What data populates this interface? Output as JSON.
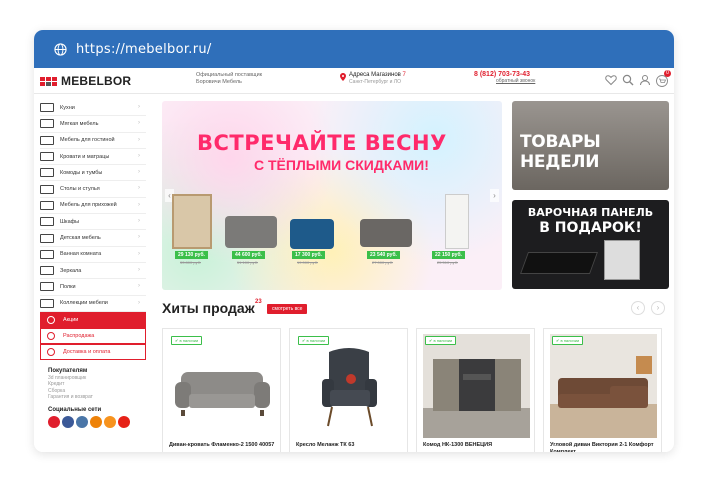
{
  "browser": {
    "url": "https://mebelbor.ru/"
  },
  "header": {
    "logo_text": "MEBELBOR",
    "official_line1": "Официальный поставщик",
    "official_line2": "Боровичи Мебель",
    "address_label": "Адреса Магазинов",
    "address_count": "7",
    "address_sub": "Санкт-Петербург и ЛО",
    "phone": "8 (812) 703-73-43",
    "callback": "обратный звонок",
    "cart_count": "0"
  },
  "sidebar": {
    "categories": [
      "Кухни",
      "Мягкая мебель",
      "Мебель для гостиной",
      "Кровати и матрацы",
      "Комоды и тумбы",
      "Столы и стулья",
      "Мебель для прихожей",
      "Шкафы",
      "Детская мебель",
      "Ванная комната",
      "Зеркала",
      "Полки",
      "Коллекции мебели"
    ],
    "promos": [
      "Акции",
      "Распродажа",
      "Доставка и оплата"
    ],
    "buyers_title": "Покупателям",
    "buyers_links": [
      "3d планировщик",
      "Кредит",
      "Сборка",
      "Гарантия и возврат"
    ],
    "social_title": "Социальные сети",
    "social_colors": [
      "#e01e2d",
      "#3b5998",
      "#4a76a8",
      "#ee8208",
      "#f7931e",
      "#e62117"
    ]
  },
  "hero": {
    "title": "ВСТРЕЧАЙТЕ ВЕСНУ",
    "subtitle": "С ТЁПЛЫМИ СКИДКАМИ!",
    "prices": [
      "29 130 руб.",
      "44 600 руб.",
      "17 300 руб.",
      "23 540 руб.",
      "22 150 руб."
    ],
    "old_prices": [
      "33 800 руб.",
      "51 100 руб.",
      "19 000 руб.",
      "27 000 руб.",
      "25 510 руб."
    ]
  },
  "banner1": {
    "text": "ТОВАРЫ НЕДЕЛИ"
  },
  "banner2": {
    "line1": "ВАРОЧНАЯ ПАНЕЛЬ",
    "line2": "В ПОДАРОК!"
  },
  "hits": {
    "title": "Хиты продаж",
    "count": "23",
    "see_all": "смотреть все",
    "products": [
      {
        "badge": "✔ в наличии",
        "name": "Диван-кровать Фламенко-2 1500 40057"
      },
      {
        "badge": "✔ в наличии",
        "name": "Кресло Меланж ТК 63"
      },
      {
        "badge": "✔ в наличии",
        "name": "Комод НК-1300 ВЕНЕЦИЯ"
      },
      {
        "badge": "✔ в наличии",
        "name": "Угловой диван Виктория 2-1 Комфорт Комплект"
      }
    ]
  }
}
